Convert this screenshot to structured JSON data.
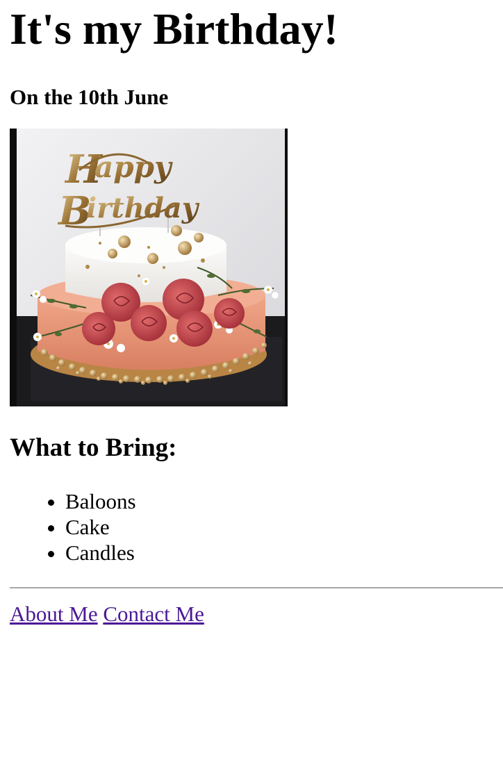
{
  "page": {
    "title": "It's my Birthday!",
    "subtitle": "On the 10th June"
  },
  "image": {
    "alt": "Happy Birthday cake",
    "topper_text": "Happy Birthday"
  },
  "bring": {
    "heading": "What to Bring:",
    "items": [
      "Baloons",
      "Cake",
      "Candles"
    ]
  },
  "footer_links": {
    "about": "About Me",
    "contact": "Contact Me"
  },
  "colors": {
    "link": "#4b1896",
    "divider": "#a6a6a6",
    "cake_base": "#e8957a",
    "cake_top": "#f6f4f1",
    "roses": "#c9404a",
    "gold": "#b08a4a"
  }
}
